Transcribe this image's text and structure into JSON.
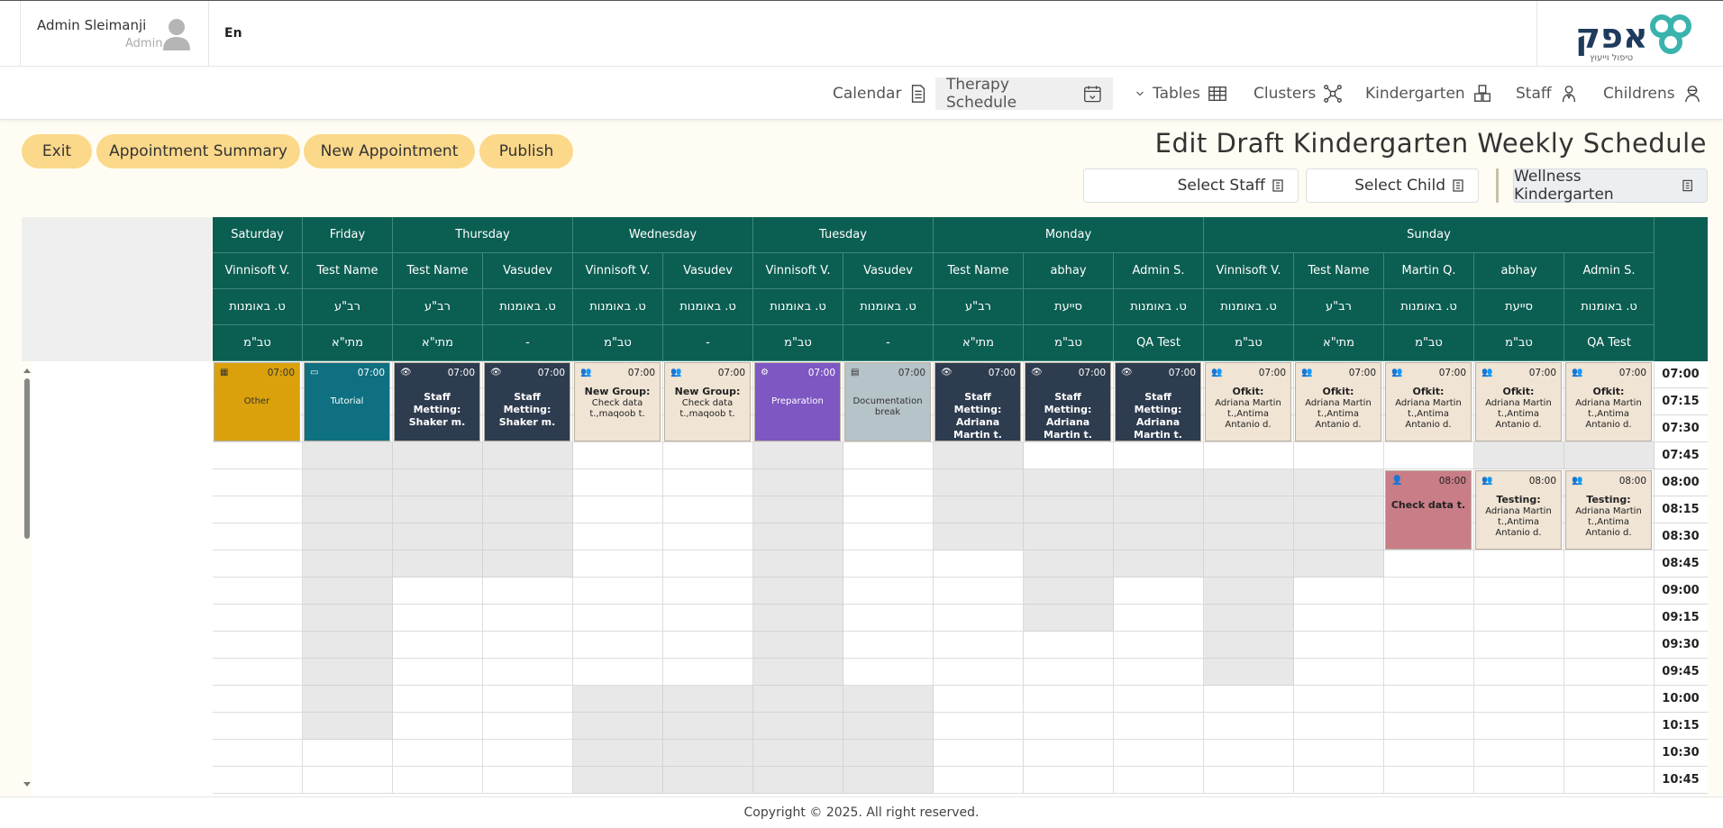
{
  "header": {
    "user_name": "Admin Sleimanji",
    "user_role": "Admin",
    "language": "En",
    "logo_text": "אפק",
    "logo_sub": "טיפול וייעוץ"
  },
  "nav": [
    {
      "label": "Childrens",
      "icon": "children-icon"
    },
    {
      "label": "Staff",
      "icon": "staff-icon"
    },
    {
      "label": "Kindergarten",
      "icon": "kindergarten-icon"
    },
    {
      "label": "Clusters",
      "icon": "clusters-icon"
    },
    {
      "label": "Tables",
      "icon": "tables-icon"
    },
    {
      "label": "Therapy Schedule",
      "icon": "therapy-schedule-icon",
      "active": true
    },
    {
      "label": "Calendar",
      "icon": "calendar-doc-icon"
    }
  ],
  "actions": {
    "exit": "Exit",
    "summary": "Appointment Summary",
    "new_appointment": "New Appointment",
    "publish": "Publish"
  },
  "page_title": "Edit Draft Kindergarten Weekly Schedule",
  "filters": {
    "kindergarten": "Wellness Kindergarten",
    "child": "Select Child",
    "staff": "Select Staff"
  },
  "days": [
    "Sunday",
    "Monday",
    "Tuesday",
    "Wednesday",
    "Thursday",
    "Friday",
    "Saturday"
  ],
  "columns": [
    {
      "day": 0,
      "staff": "Admin S.",
      "role": "ט. באומנות",
      "sub": "QA Test"
    },
    {
      "day": 0,
      "staff": "abhay",
      "role": "סייעת",
      "sub": "טב\"מ"
    },
    {
      "day": 0,
      "staff": "Martin Q.",
      "role": "ט. באומנות",
      "sub": "טב\"מ"
    },
    {
      "day": 0,
      "staff": "Test Name",
      "role": "רב\"ע",
      "sub": "מתי\"א"
    },
    {
      "day": 0,
      "staff": "Vinnisoft V.",
      "role": "ט. באומנות",
      "sub": "טב\"מ"
    },
    {
      "day": 1,
      "staff": "Admin S.",
      "role": "ט. באומנות",
      "sub": "QA Test"
    },
    {
      "day": 1,
      "staff": "abhay",
      "role": "סייעת",
      "sub": "טב\"מ"
    },
    {
      "day": 1,
      "staff": "Test Name",
      "role": "רב\"ע",
      "sub": "מתי\"א"
    },
    {
      "day": 2,
      "staff": "Vasudev",
      "role": "ט. באומנות",
      "sub": "-"
    },
    {
      "day": 2,
      "staff": "Vinnisoft V.",
      "role": "ט. באומנות",
      "sub": "טב\"מ"
    },
    {
      "day": 3,
      "staff": "Vasudev",
      "role": "ט. באומנות",
      "sub": "-"
    },
    {
      "day": 3,
      "staff": "Vinnisoft V.",
      "role": "ט. באומנות",
      "sub": "טב\"מ"
    },
    {
      "day": 4,
      "staff": "Vasudev",
      "role": "ט. באומנות",
      "sub": "-"
    },
    {
      "day": 4,
      "staff": "Test Name",
      "role": "רב\"ע",
      "sub": "מתי\"א"
    },
    {
      "day": 5,
      "staff": "Test Name",
      "role": "רב\"ע",
      "sub": "מתי\"א"
    },
    {
      "day": 6,
      "staff": "Vinnisoft V.",
      "role": "ט. באומנות",
      "sub": "טב\"מ"
    }
  ],
  "times": [
    "07:00",
    "07:15",
    "07:30",
    "07:45",
    "08:00",
    "08:15",
    "08:30",
    "08:45",
    "09:00",
    "09:15",
    "09:30",
    "09:45",
    "10:00",
    "10:15",
    "10:30",
    "10:45"
  ],
  "blocked": [
    [
      0,
      3
    ],
    [
      1,
      3
    ],
    [
      3,
      4
    ],
    [
      3,
      5
    ],
    [
      3,
      6
    ],
    [
      3,
      7
    ],
    [
      4,
      4
    ],
    [
      4,
      5
    ],
    [
      4,
      6
    ],
    [
      4,
      7
    ],
    [
      4,
      8
    ],
    [
      4,
      9
    ],
    [
      4,
      10
    ],
    [
      4,
      11
    ],
    [
      5,
      4
    ],
    [
      5,
      5
    ],
    [
      5,
      6
    ],
    [
      5,
      7
    ],
    [
      6,
      4
    ],
    [
      6,
      5
    ],
    [
      6,
      6
    ],
    [
      6,
      7
    ],
    [
      6,
      8
    ],
    [
      6,
      9
    ],
    [
      7,
      3
    ],
    [
      7,
      4
    ],
    [
      7,
      5
    ],
    [
      7,
      6
    ],
    [
      8,
      12
    ],
    [
      8,
      13
    ],
    [
      8,
      14
    ],
    [
      8,
      15
    ],
    [
      9,
      3
    ],
    [
      9,
      4
    ],
    [
      9,
      5
    ],
    [
      9,
      6
    ],
    [
      9,
      7
    ],
    [
      9,
      8
    ],
    [
      9,
      9
    ],
    [
      9,
      10
    ],
    [
      9,
      11
    ],
    [
      9,
      12
    ],
    [
      9,
      13
    ],
    [
      9,
      14
    ],
    [
      9,
      15
    ],
    [
      10,
      12
    ],
    [
      10,
      13
    ],
    [
      10,
      14
    ],
    [
      10,
      15
    ],
    [
      11,
      12
    ],
    [
      11,
      13
    ],
    [
      11,
      14
    ],
    [
      11,
      15
    ],
    [
      12,
      3
    ],
    [
      12,
      4
    ],
    [
      12,
      5
    ],
    [
      12,
      6
    ],
    [
      12,
      7
    ],
    [
      13,
      3
    ],
    [
      13,
      4
    ],
    [
      13,
      5
    ],
    [
      13,
      6
    ],
    [
      13,
      7
    ],
    [
      14,
      3
    ],
    [
      14,
      4
    ],
    [
      14,
      5
    ],
    [
      14,
      6
    ],
    [
      14,
      7
    ],
    [
      14,
      8
    ],
    [
      14,
      9
    ],
    [
      14,
      10
    ],
    [
      14,
      11
    ],
    [
      14,
      12
    ],
    [
      14,
      13
    ]
  ],
  "appointments": [
    {
      "col": 0,
      "start": 0,
      "span": 3,
      "time": "07:00",
      "icon": "group-icon",
      "title": "Ofkit:",
      "sub": "Adriana Martin t.,Antima Antanio d.",
      "bg": "#f0e4d4",
      "fg": "#222"
    },
    {
      "col": 1,
      "start": 0,
      "span": 3,
      "time": "07:00",
      "icon": "group-icon",
      "title": "Ofkit:",
      "sub": "Adriana Martin t.,Antima Antanio d.",
      "bg": "#f0e4d4",
      "fg": "#222"
    },
    {
      "col": 2,
      "start": 0,
      "span": 3,
      "time": "07:00",
      "icon": "group-icon",
      "title": "Ofkit:",
      "sub": "Adriana Martin t.,Antima Antanio d.",
      "bg": "#f0e4d4",
      "fg": "#222"
    },
    {
      "col": 3,
      "start": 0,
      "span": 3,
      "time": "07:00",
      "icon": "group-icon",
      "title": "Ofkit:",
      "sub": "Adriana Martin t.,Antima Antanio d.",
      "bg": "#f0e4d4",
      "fg": "#222"
    },
    {
      "col": 4,
      "start": 0,
      "span": 3,
      "time": "07:00",
      "icon": "group-icon",
      "title": "Ofkit:",
      "sub": "Adriana Martin t.,Antima Antanio d.",
      "bg": "#f0e4d4",
      "fg": "#222"
    },
    {
      "col": 0,
      "start": 4,
      "span": 3,
      "time": "08:00",
      "icon": "group-icon",
      "title": "Testing:",
      "sub": "Adriana Martin t.,Antima Antanio d.",
      "bg": "#f0e4d4",
      "fg": "#222"
    },
    {
      "col": 1,
      "start": 4,
      "span": 3,
      "time": "08:00",
      "icon": "group-icon",
      "title": "Testing:",
      "sub": "Adriana Martin t.,Antima Antanio d.",
      "bg": "#f0e4d4",
      "fg": "#222"
    },
    {
      "col": 2,
      "start": 4,
      "span": 3,
      "time": "08:00",
      "icon": "person-icon",
      "title": "Check data t.",
      "sub": "",
      "bg": "#c97d86",
      "fg": "#222"
    },
    {
      "col": 5,
      "start": 0,
      "span": 3,
      "time": "07:00",
      "icon": "eye-icon",
      "title": "Staff Metting: Adriana Martin t.",
      "sub": "",
      "bg": "#2e3c4f",
      "fg": "#fff"
    },
    {
      "col": 6,
      "start": 0,
      "span": 3,
      "time": "07:00",
      "icon": "eye-icon",
      "title": "Staff Metting: Adriana Martin t.",
      "sub": "",
      "bg": "#2e3c4f",
      "fg": "#fff"
    },
    {
      "col": 7,
      "start": 0,
      "span": 3,
      "time": "07:00",
      "icon": "eye-icon",
      "title": "Staff Metting: Adriana Martin t.",
      "sub": "",
      "bg": "#2e3c4f",
      "fg": "#fff"
    },
    {
      "col": 8,
      "start": 0,
      "span": 3,
      "time": "07:00",
      "icon": "book-icon",
      "title": "",
      "sub": "Documentation break",
      "bg": "#b6c3c8",
      "fg": "#333"
    },
    {
      "col": 9,
      "start": 0,
      "span": 3,
      "time": "07:00",
      "icon": "gears-icon",
      "title": "",
      "sub": "Preparation",
      "bg": "#7e57c2",
      "fg": "#fff"
    },
    {
      "col": 10,
      "start": 0,
      "span": 3,
      "time": "07:00",
      "icon": "group-icon",
      "title": "New Group:",
      "sub": "Check data t.,maqoob t.",
      "bg": "#f0e4d4",
      "fg": "#222"
    },
    {
      "col": 11,
      "start": 0,
      "span": 3,
      "time": "07:00",
      "icon": "group-icon",
      "title": "New Group:",
      "sub": "Check data t.,maqoob t.",
      "bg": "#f0e4d4",
      "fg": "#222"
    },
    {
      "col": 12,
      "start": 0,
      "span": 3,
      "time": "07:00",
      "icon": "eye-icon",
      "title": "Staff Metting: Shaker m.",
      "sub": "",
      "bg": "#2e3c4f",
      "fg": "#fff"
    },
    {
      "col": 13,
      "start": 0,
      "span": 3,
      "time": "07:00",
      "icon": "eye-icon",
      "title": "Staff Metting: Shaker m.",
      "sub": "",
      "bg": "#2e3c4f",
      "fg": "#fff"
    },
    {
      "col": 14,
      "start": 0,
      "span": 3,
      "time": "07:00",
      "icon": "laptop-icon",
      "title": "",
      "sub": "Tutorial",
      "bg": "#0e7080",
      "fg": "#fff"
    },
    {
      "col": 15,
      "start": 0,
      "span": 3,
      "time": "07:00",
      "icon": "grid-icon",
      "title": "",
      "sub": "Other",
      "bg": "#daa10c",
      "fg": "#333"
    }
  ],
  "footer": "Copyright © 2025. All right reserved."
}
